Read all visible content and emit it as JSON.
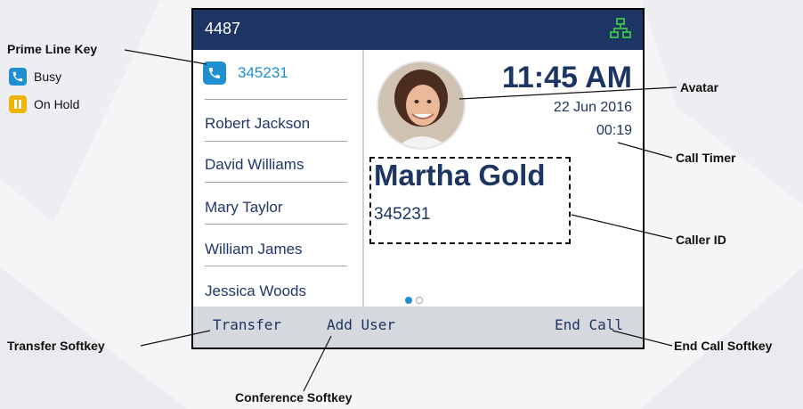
{
  "phone": {
    "extension": "4487",
    "prime_line": {
      "number": "345231"
    },
    "lines": [
      "Robert Jackson",
      "David Williams",
      "Mary Taylor",
      "William James",
      "Jessica Woods"
    ],
    "time": "11:45 AM",
    "date": "22 Jun 2016",
    "call_timer": "00:19",
    "caller_name": "Martha Gold",
    "caller_number": "345231",
    "softkeys": {
      "transfer": "Transfer",
      "add_user": "Add User",
      "end_call": "End Call"
    }
  },
  "legend": {
    "busy": "Busy",
    "on_hold": "On Hold"
  },
  "callouts": {
    "prime_line_key": "Prime Line Key",
    "avatar": "Avatar",
    "call_timer": "Call Timer",
    "caller_id": "Caller ID",
    "transfer_softkey": "Transfer Softkey",
    "conference_softkey": "Conference Softkey",
    "end_call_softkey": "End Call Softkey"
  },
  "colors": {
    "header": "#1d3562",
    "busy_icon": "#1f8fd2",
    "hold_icon": "#f0b400",
    "network_icon": "#39b54a",
    "softkey_bar": "#d5d8dd"
  }
}
